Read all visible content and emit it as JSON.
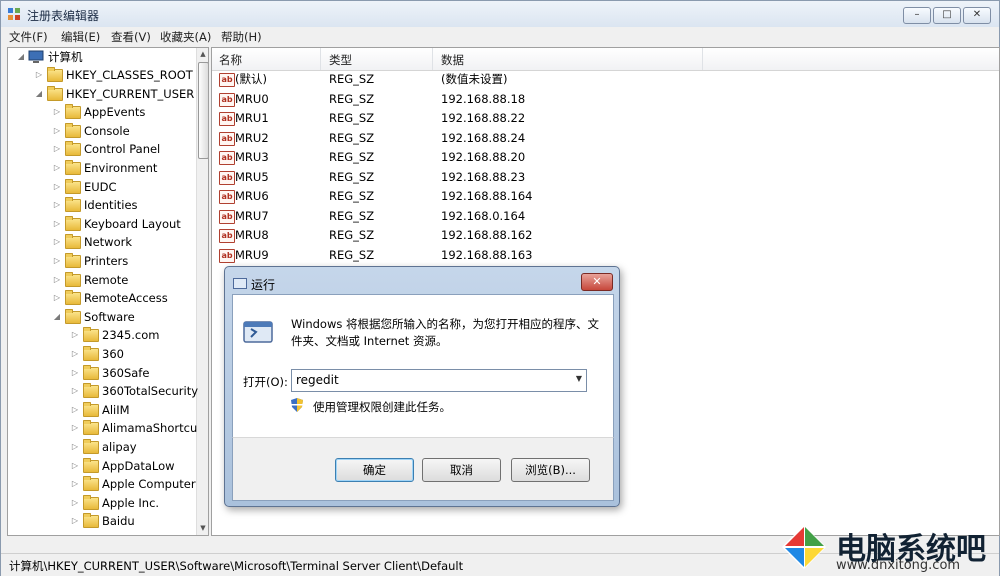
{
  "window": {
    "title": "注册表编辑器"
  },
  "menu": [
    "文件(F)",
    "编辑(E)",
    "查看(V)",
    "收藏夹(A)",
    "帮助(H)"
  ],
  "tree": {
    "root": "计算机",
    "items": [
      {
        "label": "HKEY_CLASSES_ROOT",
        "level": 1,
        "expanded": false
      },
      {
        "label": "HKEY_CURRENT_USER",
        "level": 1,
        "expanded": true
      },
      {
        "label": "AppEvents",
        "level": 2,
        "expanded": false
      },
      {
        "label": "Console",
        "level": 2,
        "expanded": false
      },
      {
        "label": "Control Panel",
        "level": 2,
        "expanded": false
      },
      {
        "label": "Environment",
        "level": 2,
        "expanded": false
      },
      {
        "label": "EUDC",
        "level": 2,
        "expanded": false
      },
      {
        "label": "Identities",
        "level": 2,
        "expanded": false
      },
      {
        "label": "Keyboard Layout",
        "level": 2,
        "expanded": false
      },
      {
        "label": "Network",
        "level": 2,
        "expanded": false
      },
      {
        "label": "Printers",
        "level": 2,
        "expanded": false
      },
      {
        "label": "Remote",
        "level": 2,
        "expanded": false
      },
      {
        "label": "RemoteAccess",
        "level": 2,
        "expanded": false
      },
      {
        "label": "Software",
        "level": 2,
        "expanded": true
      },
      {
        "label": "2345.com",
        "level": 3,
        "expanded": false
      },
      {
        "label": "360",
        "level": 3,
        "expanded": false
      },
      {
        "label": "360Safe",
        "level": 3,
        "expanded": false
      },
      {
        "label": "360TotalSecurity",
        "level": 3,
        "expanded": false
      },
      {
        "label": "AliIM",
        "level": 3,
        "expanded": false
      },
      {
        "label": "AlimamaShortcu",
        "level": 3,
        "expanded": false
      },
      {
        "label": "alipay",
        "level": 3,
        "expanded": false
      },
      {
        "label": "AppDataLow",
        "level": 3,
        "expanded": false
      },
      {
        "label": "Apple Computer",
        "level": 3,
        "expanded": false
      },
      {
        "label": "Apple Inc.",
        "level": 3,
        "expanded": false
      },
      {
        "label": "Baidu",
        "level": 3,
        "expanded": false
      }
    ]
  },
  "list": {
    "columns": [
      "名称",
      "类型",
      "数据"
    ],
    "rows": [
      {
        "name": "(默认)",
        "type": "REG_SZ",
        "data": "(数值未设置)"
      },
      {
        "name": "MRU0",
        "type": "REG_SZ",
        "data": "192.168.88.18"
      },
      {
        "name": "MRU1",
        "type": "REG_SZ",
        "data": "192.168.88.22"
      },
      {
        "name": "MRU2",
        "type": "REG_SZ",
        "data": "192.168.88.24"
      },
      {
        "name": "MRU3",
        "type": "REG_SZ",
        "data": "192.168.88.20"
      },
      {
        "name": "MRU5",
        "type": "REG_SZ",
        "data": "192.168.88.23"
      },
      {
        "name": "MRU6",
        "type": "REG_SZ",
        "data": "192.168.88.164"
      },
      {
        "name": "MRU7",
        "type": "REG_SZ",
        "data": "192.168.0.164"
      },
      {
        "name": "MRU8",
        "type": "REG_SZ",
        "data": "192.168.88.162"
      },
      {
        "name": "MRU9",
        "type": "REG_SZ",
        "data": "192.168.88.163"
      }
    ]
  },
  "status": "计算机\\HKEY_CURRENT_USER\\Software\\Microsoft\\Terminal Server Client\\Default",
  "run_dialog": {
    "title": "运行",
    "description": "Windows 将根据您所输入的名称，为您打开相应的程序、文件夹、文档或 Internet 资源。",
    "open_label": "打开(O):",
    "input_value": "regedit",
    "admin_note": "使用管理权限创建此任务。",
    "ok": "确定",
    "cancel": "取消",
    "browse": "浏览(B)..."
  },
  "watermark": {
    "brand": "电脑系统吧",
    "url": "www.dnxitong.com"
  },
  "colors": {
    "accent": "#3c7fb1",
    "close": "#c7473b",
    "folder": "#e8b93a"
  }
}
